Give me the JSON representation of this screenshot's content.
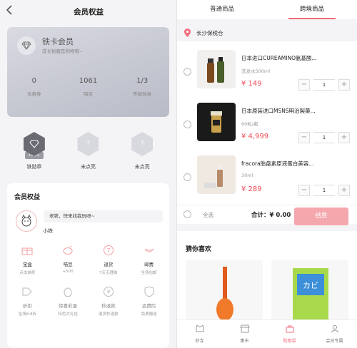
{
  "left": {
    "title": "会员权益",
    "card": {
      "level": "铁卡会员",
      "desc": "成长秘籍是购物哦~",
      "stats": [
        {
          "num": "0",
          "label": "优惠券"
        },
        {
          "num": "1061",
          "label": "喵豆"
        },
        {
          "num": "1/3",
          "label": "等级勋章"
        }
      ]
    },
    "badges": [
      {
        "label": "铁勋章",
        "tag": "IRON",
        "state": "lit"
      },
      {
        "label": "未点亮",
        "state": "unlit"
      },
      {
        "label": "未点亮",
        "state": "unlit"
      }
    ],
    "rights": {
      "title": "会员权益",
      "bubble": "老铁，快来找我玩呀~",
      "username": "小铁",
      "row1": [
        {
          "name": "宝盒",
          "sub": "点击抽奖",
          "icon": "gift-box-icon"
        },
        {
          "name": "喵豆",
          "sub": "+500",
          "icon": "piggy-bank-icon"
        },
        {
          "name": "退货",
          "sub": "7天无理由",
          "icon": "return-7-icon"
        },
        {
          "name": "邮费",
          "sub": "全场包邮",
          "icon": "shipping-icon"
        }
      ],
      "row2": [
        {
          "name": "折扣",
          "sub": "全场8.8折",
          "icon": "discount-tag-icon"
        },
        {
          "name": "惊喜彩蛋",
          "sub": "特色大礼包",
          "icon": "egg-icon"
        },
        {
          "name": "秒退款",
          "sub": "退货秒退款",
          "icon": "refund-icon"
        },
        {
          "name": "运费险",
          "sub": "免费赠送",
          "icon": "insurance-shield-icon"
        }
      ]
    }
  },
  "right": {
    "tabs": [
      "普通商品",
      "跨境商品"
    ],
    "active_tab": 1,
    "store": "长沙保税仓",
    "items": [
      {
        "name": "日本进口CUREAMINO氨基酸...",
        "spec": "洗发水500ml",
        "price": "¥ 149",
        "qty": "1"
      },
      {
        "name": "日本原装进口MSNS明治製菓...",
        "spec": "60粒/瓶",
        "price": "¥ 4,999",
        "qty": "1"
      },
      {
        "name": "fracora胎盘素原液蛋白美容...",
        "spec": "30ml",
        "price": "¥ 289",
        "qty": "1"
      }
    ],
    "footer": {
      "select_all": "全选",
      "total": "合计：¥ 0.00",
      "checkout": "结算"
    },
    "guess_title": "猜你喜欢",
    "tabbar": [
      {
        "label": "秒寺",
        "icon": "cat-icon"
      },
      {
        "label": "集市",
        "icon": "market-icon"
      },
      {
        "label": "购物袋",
        "icon": "shopping-bag-icon"
      },
      {
        "label": "会员专属",
        "icon": "member-icon"
      }
    ],
    "active_tabbar": 2
  },
  "colors": {
    "accent": "#f26d7d",
    "price": "#f04a55",
    "checkout": "#f5a7ae"
  }
}
